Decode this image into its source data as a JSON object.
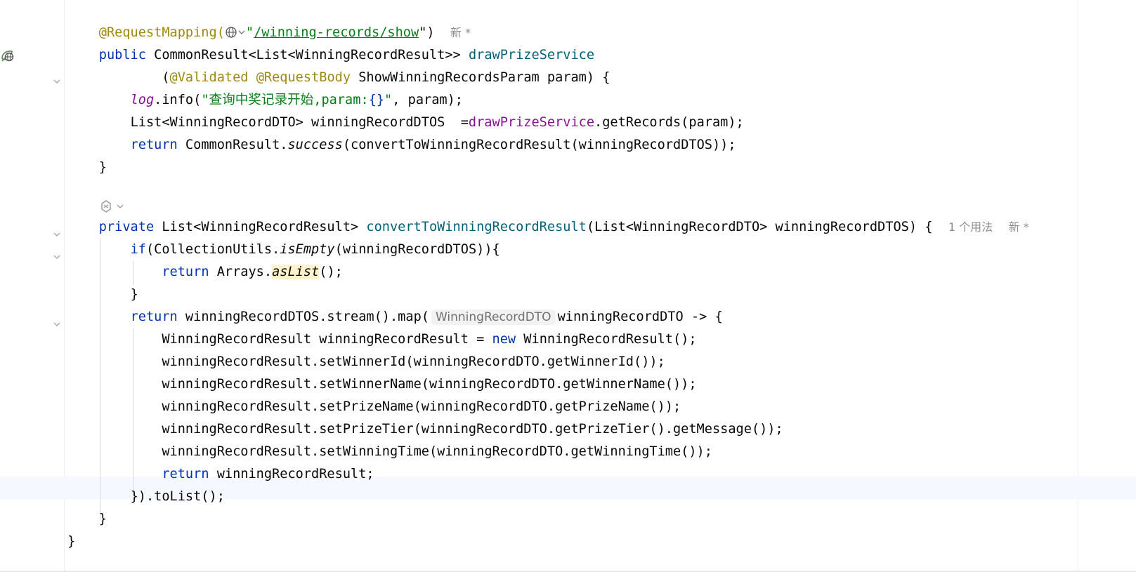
{
  "editor": {
    "hints": {
      "new_marker": "新 *",
      "usages": "1 个用法",
      "param_type_inlay": "WinningRecordDTO"
    },
    "code": {
      "l1": {
        "ann": "@RequestMapping(",
        "path": "/winning-records/show",
        "close": "\")"
      },
      "l2": {
        "kw": "public",
        "type": " CommonResult<List<WinningRecordResult>> ",
        "fn": "drawPrizeService"
      },
      "l3": {
        "open": "(",
        "ann1": "@Validated",
        "ann2": "@RequestBody",
        "rest": " ShowWinningRecordsParam param) {"
      },
      "l4": {
        "log": "log",
        "call": ".info(",
        "str": "\"查询中奖记录开始,param:",
        "brace": "{}",
        "strend": "\"",
        "rest": ", param);"
      },
      "l5": {
        "decl": "List<WinningRecordDTO> winningRecordDTOS  =",
        "field": "drawPrizeService",
        "rest": ".getRecords(param);"
      },
      "l6": {
        "kw": "return",
        "pre": " CommonResult.",
        "it": "success",
        "rest": "(convertToWinningRecordResult(winningRecordDTOS));"
      },
      "l7": "}",
      "l9": {
        "kw": "private",
        "type": " List<WinningRecordResult> ",
        "fn": "convertToWinningRecordResult",
        "rest": "(List<WinningRecordDTO> winningRecordDTOS) {"
      },
      "l10": {
        "kw": "if",
        "pre": "(CollectionUtils.",
        "it": "isEmpty",
        "rest": "(winningRecordDTOS)){"
      },
      "l11": {
        "kw": "return",
        "pre": " Arrays.",
        "it": "asList",
        "rest": "();"
      },
      "l12": "}",
      "l13": {
        "kw": "return",
        "pre": " winningRecordDTOS.stream().map(",
        "rest": "winningRecordDTO -> {"
      },
      "l14": {
        "pre": "WinningRecordResult winningRecordResult = ",
        "kw": "new",
        "rest": " WinningRecordResult();"
      },
      "l15": "winningRecordResult.setWinnerId(winningRecordDTO.getWinnerId());",
      "l16": "winningRecordResult.setWinnerName(winningRecordDTO.getWinnerName());",
      "l17": "winningRecordResult.setPrizeName(winningRecordDTO.getPrizeName());",
      "l18": "winningRecordResult.setPrizeTier(winningRecordDTO.getPrizeTier().getMessage());",
      "l19": "winningRecordResult.setWinningTime(winningRecordDTO.getWinningTime());",
      "l20": {
        "kw": "return",
        "rest": " winningRecordResult;"
      },
      "l21": "}).toList();",
      "l22": "}",
      "l23": "}"
    }
  }
}
